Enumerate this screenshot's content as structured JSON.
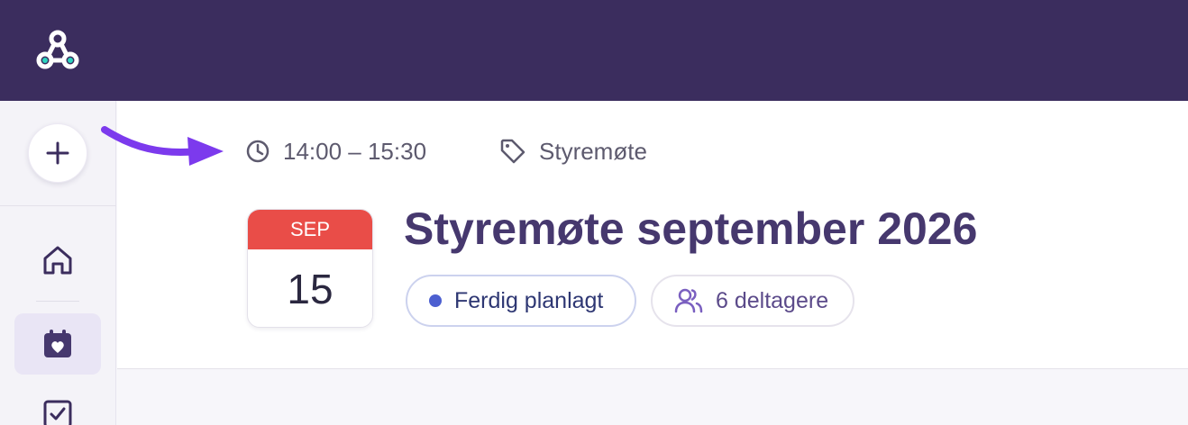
{
  "event": {
    "time_range": "14:00 – 15:30",
    "category": "Styremøte",
    "title": "Styremøte september 2026",
    "date": {
      "month": "SEP",
      "day": "15"
    },
    "status": "Ferdig planlagt",
    "participants": "6 deltagere"
  },
  "colors": {
    "topbar": "#3b2d5e",
    "accent": "#46386e",
    "calendar_header": "#e94d48",
    "status_dot": "#4c5fd0",
    "arrow": "#7c3aed"
  },
  "icons": {
    "logo": "app-logo",
    "add": "plus-icon",
    "home": "home-icon",
    "calendar": "calendar-heart-icon",
    "tasks": "checkbox-icon",
    "time": "clock-icon",
    "tag": "tag-icon",
    "participants": "users-icon"
  }
}
